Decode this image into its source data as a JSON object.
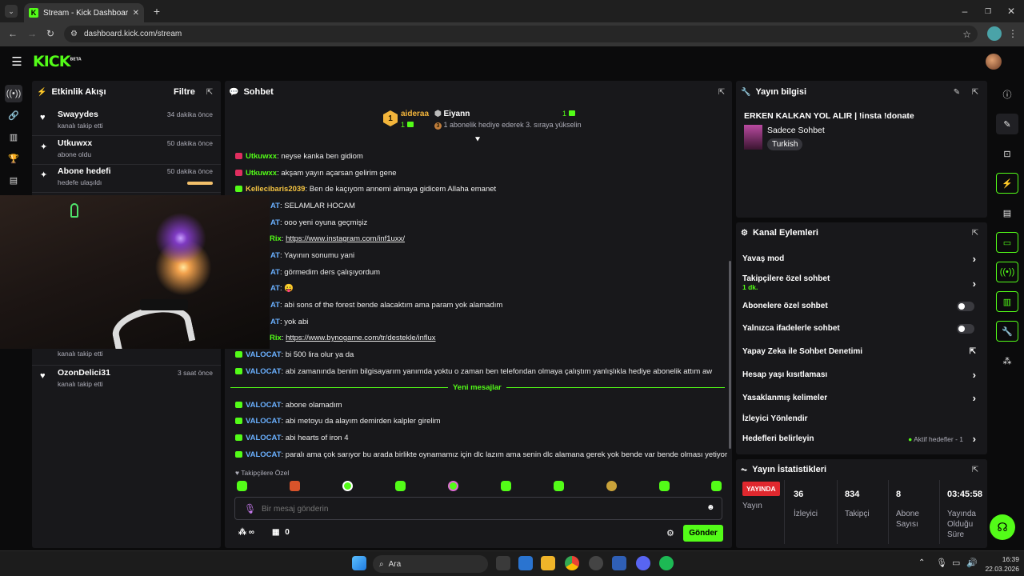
{
  "browser": {
    "tab_title": "Stream - Kick Dashboard",
    "url": "dashboard.kick.com/stream"
  },
  "activity": {
    "title": "Etkinlik Akışı",
    "filter": "Filtre",
    "items": [
      {
        "name": "Swayydes",
        "sub": "kanalı takip etti",
        "time": "34 dakika önce",
        "icon": "heart-icon"
      },
      {
        "name": "Utkuwxx",
        "sub": "abone oldu",
        "time": "50 dakika önce",
        "icon": "star-icon"
      },
      {
        "name": "Abone hedefi",
        "sub": "hedefe ulaşıldı",
        "time": "50 dakika önce",
        "icon": "star-icon",
        "progress": 1.0
      },
      {
        "name": "",
        "sub": "kanalı takip etti",
        "time": "",
        "icon": "heart-icon"
      },
      {
        "name": "OzonDelici31",
        "sub": "kanalı takip etti",
        "time": "3 saat önce",
        "icon": "heart-icon"
      }
    ]
  },
  "chat": {
    "title": "Sohbet",
    "pinned": {
      "rank": "1",
      "user1": "aideraa",
      "user1_count": "1",
      "user2": "Eiyann",
      "user2_count": "1",
      "user2_rank": "3",
      "note": "1 abonelik hediye ederek 3. sıraya yükselin"
    },
    "messages": [
      {
        "user": "Utkuwxx",
        "color": "#53fc18",
        "badge": "red",
        "text": ": neyse kanka ben gidiom"
      },
      {
        "user": "Utkuwxx",
        "color": "#53fc18",
        "badge": "red",
        "text": ": akşam yayın açarsan gelirim gene"
      },
      {
        "user": "Kellecibaris2039",
        "color": "#f5c542",
        "badge": "green",
        "text": ": Ben de kaçıyom annemi almaya gidicem Allaha emanet"
      },
      {
        "user": "AT",
        "color": "#6ab0ff",
        "badge": "none",
        "text": ": SELAMLAR HOCAM"
      },
      {
        "user": "AT",
        "color": "#6ab0ff",
        "badge": "none",
        "text": ": ooo yeni oyuna geçmişiz"
      },
      {
        "user": "Rix",
        "color": "#53fc18",
        "badge": "none",
        "text": ": ",
        "link": "https://www.instagram.com/inf1uxx/"
      },
      {
        "user": "AT",
        "color": "#6ab0ff",
        "badge": "none",
        "text": ": Yayının sonumu yani"
      },
      {
        "user": "AT",
        "color": "#6ab0ff",
        "badge": "none",
        "text": ": görmedim ders çalışıyordum"
      },
      {
        "user": "AT",
        "color": "#6ab0ff",
        "badge": "none",
        "text": ": 😛"
      },
      {
        "user": "AT",
        "color": "#6ab0ff",
        "badge": "none",
        "text": ": abi sons of the forest bende alacaktım ama param yok alamadım"
      },
      {
        "user": "AT",
        "color": "#6ab0ff",
        "badge": "none",
        "text": ": yok abi"
      },
      {
        "user": "Rix",
        "color": "#53fc18",
        "badge": "none",
        "text": ": ",
        "link": "https://www.bynogame.com/tr/destekle/influx"
      },
      {
        "user": "VALOCAT",
        "color": "#6ab0ff",
        "badge": "green",
        "text": ": bi 500 lira olur ya da"
      },
      {
        "user": "VALOCAT",
        "color": "#6ab0ff",
        "badge": "green",
        "text": ": abi zamanında benim bilgisayarım yanımda yoktu o zaman ben telefondan olmaya çalıştım yanlışlıkla hediye abonelik attım aw"
      }
    ],
    "new_divider": "Yeni mesajlar",
    "new_messages": [
      {
        "user": "VALOCAT",
        "color": "#6ab0ff",
        "text": ": abone olamadım"
      },
      {
        "user": "VALOCAT",
        "color": "#6ab0ff",
        "text": ": abi metoyu da alayım demirden kalpler girelim"
      },
      {
        "user": "VALOCAT",
        "color": "#6ab0ff",
        "text": ": abi hearts of iron 4"
      },
      {
        "user": "VALOCAT",
        "color": "#6ab0ff",
        "text": ": paralı ama çok sarıyor bu arada birlikte oynamamız için dlc lazım ama senin dlc alamana gerek yok bende var bende olması yetiyor"
      }
    ],
    "emote_label": "Takipçilere Özel",
    "input_placeholder": "Bir mesaj gönderin",
    "points": "∞",
    "shop_count": "0",
    "send": "Gönder"
  },
  "stream_info": {
    "title": "Yayın bilgisi",
    "stream_title": "ERKEN KALKAN YOL ALIR | !insta !donate",
    "category": "Sadece Sohbet",
    "language": "Turkish"
  },
  "channel_actions": {
    "title": "Kanal Eylemleri",
    "items": [
      {
        "label": "Yavaş mod",
        "type": "chevron"
      },
      {
        "label": "Takipçilere özel sohbet",
        "sub": "1 dk.",
        "type": "chevron"
      },
      {
        "label": "Abonelere özel sohbet",
        "type": "toggle"
      },
      {
        "label": "Yalnızca ifadelerle sohbet",
        "type": "toggle"
      },
      {
        "label": "Yapay Zeka ile Sohbet Denetimi",
        "type": "external"
      },
      {
        "label": "Hesap yaşı kısıtlaması",
        "type": "chevron"
      },
      {
        "label": "Yasaklanmış kelimeler",
        "type": "chevron"
      },
      {
        "label": "İzleyici Yönlendir",
        "type": "none"
      },
      {
        "label": "Hedefleri belirleyin",
        "type": "chevron",
        "status": "Aktif hedefler - 1"
      }
    ]
  },
  "stats": {
    "title": "Yayın İstatistikleri",
    "live_badge": "YAYINDA",
    "live_label": "Yayın",
    "viewers": "36",
    "viewers_label": "İzleyici",
    "followers": "834",
    "followers_label": "Takipçi",
    "subs": "8",
    "subs_label": "Abone Sayısı",
    "uptime": "03:45:58",
    "uptime_label": "Yayında Olduğu Süre"
  },
  "taskbar": {
    "search": "Ara",
    "time": "16:39",
    "date": "22.03.2026"
  },
  "colors": {
    "accent": "#53fc18",
    "panel": "#18181b",
    "bg": "#0b0b0c",
    "live": "#e0282e"
  }
}
